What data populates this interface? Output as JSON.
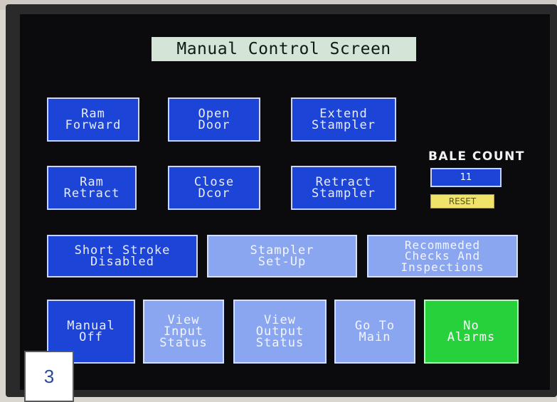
{
  "screen_title": "Manual Control Screen",
  "buttons": {
    "ram_forward": "Ram\nForward",
    "open_door": "Open\nDoor",
    "extend_stampler": "Extend\nStampler",
    "ram_retract": "Ram\nRetract",
    "close_door": "Close\nDcor",
    "retract_stampler": "Retract\nStampler",
    "short_stroke": "Short Stroke\nDisabled",
    "stampler_setup": "Stampler\nSet-Up",
    "recommended_checks": "Recommeded\nChecks And\nInspections",
    "manual_off": "Manual\nOff",
    "view_input_status": "View\nInput\nStatus",
    "view_output_status": "View\nOutput\nStatus",
    "go_to_main": "Go To\nMain",
    "no_alarms": "No\nAlarms"
  },
  "bale_count": {
    "label": "BALE COUNT",
    "value": "11",
    "reset_label": "RESET"
  },
  "callout_label": "3",
  "colors": {
    "button_dark": "#1c45d8",
    "button_light": "#8aa6f0",
    "button_green": "#27d13b",
    "reset_yellow": "#efe36a",
    "title_bg": "#d4e4d6"
  }
}
